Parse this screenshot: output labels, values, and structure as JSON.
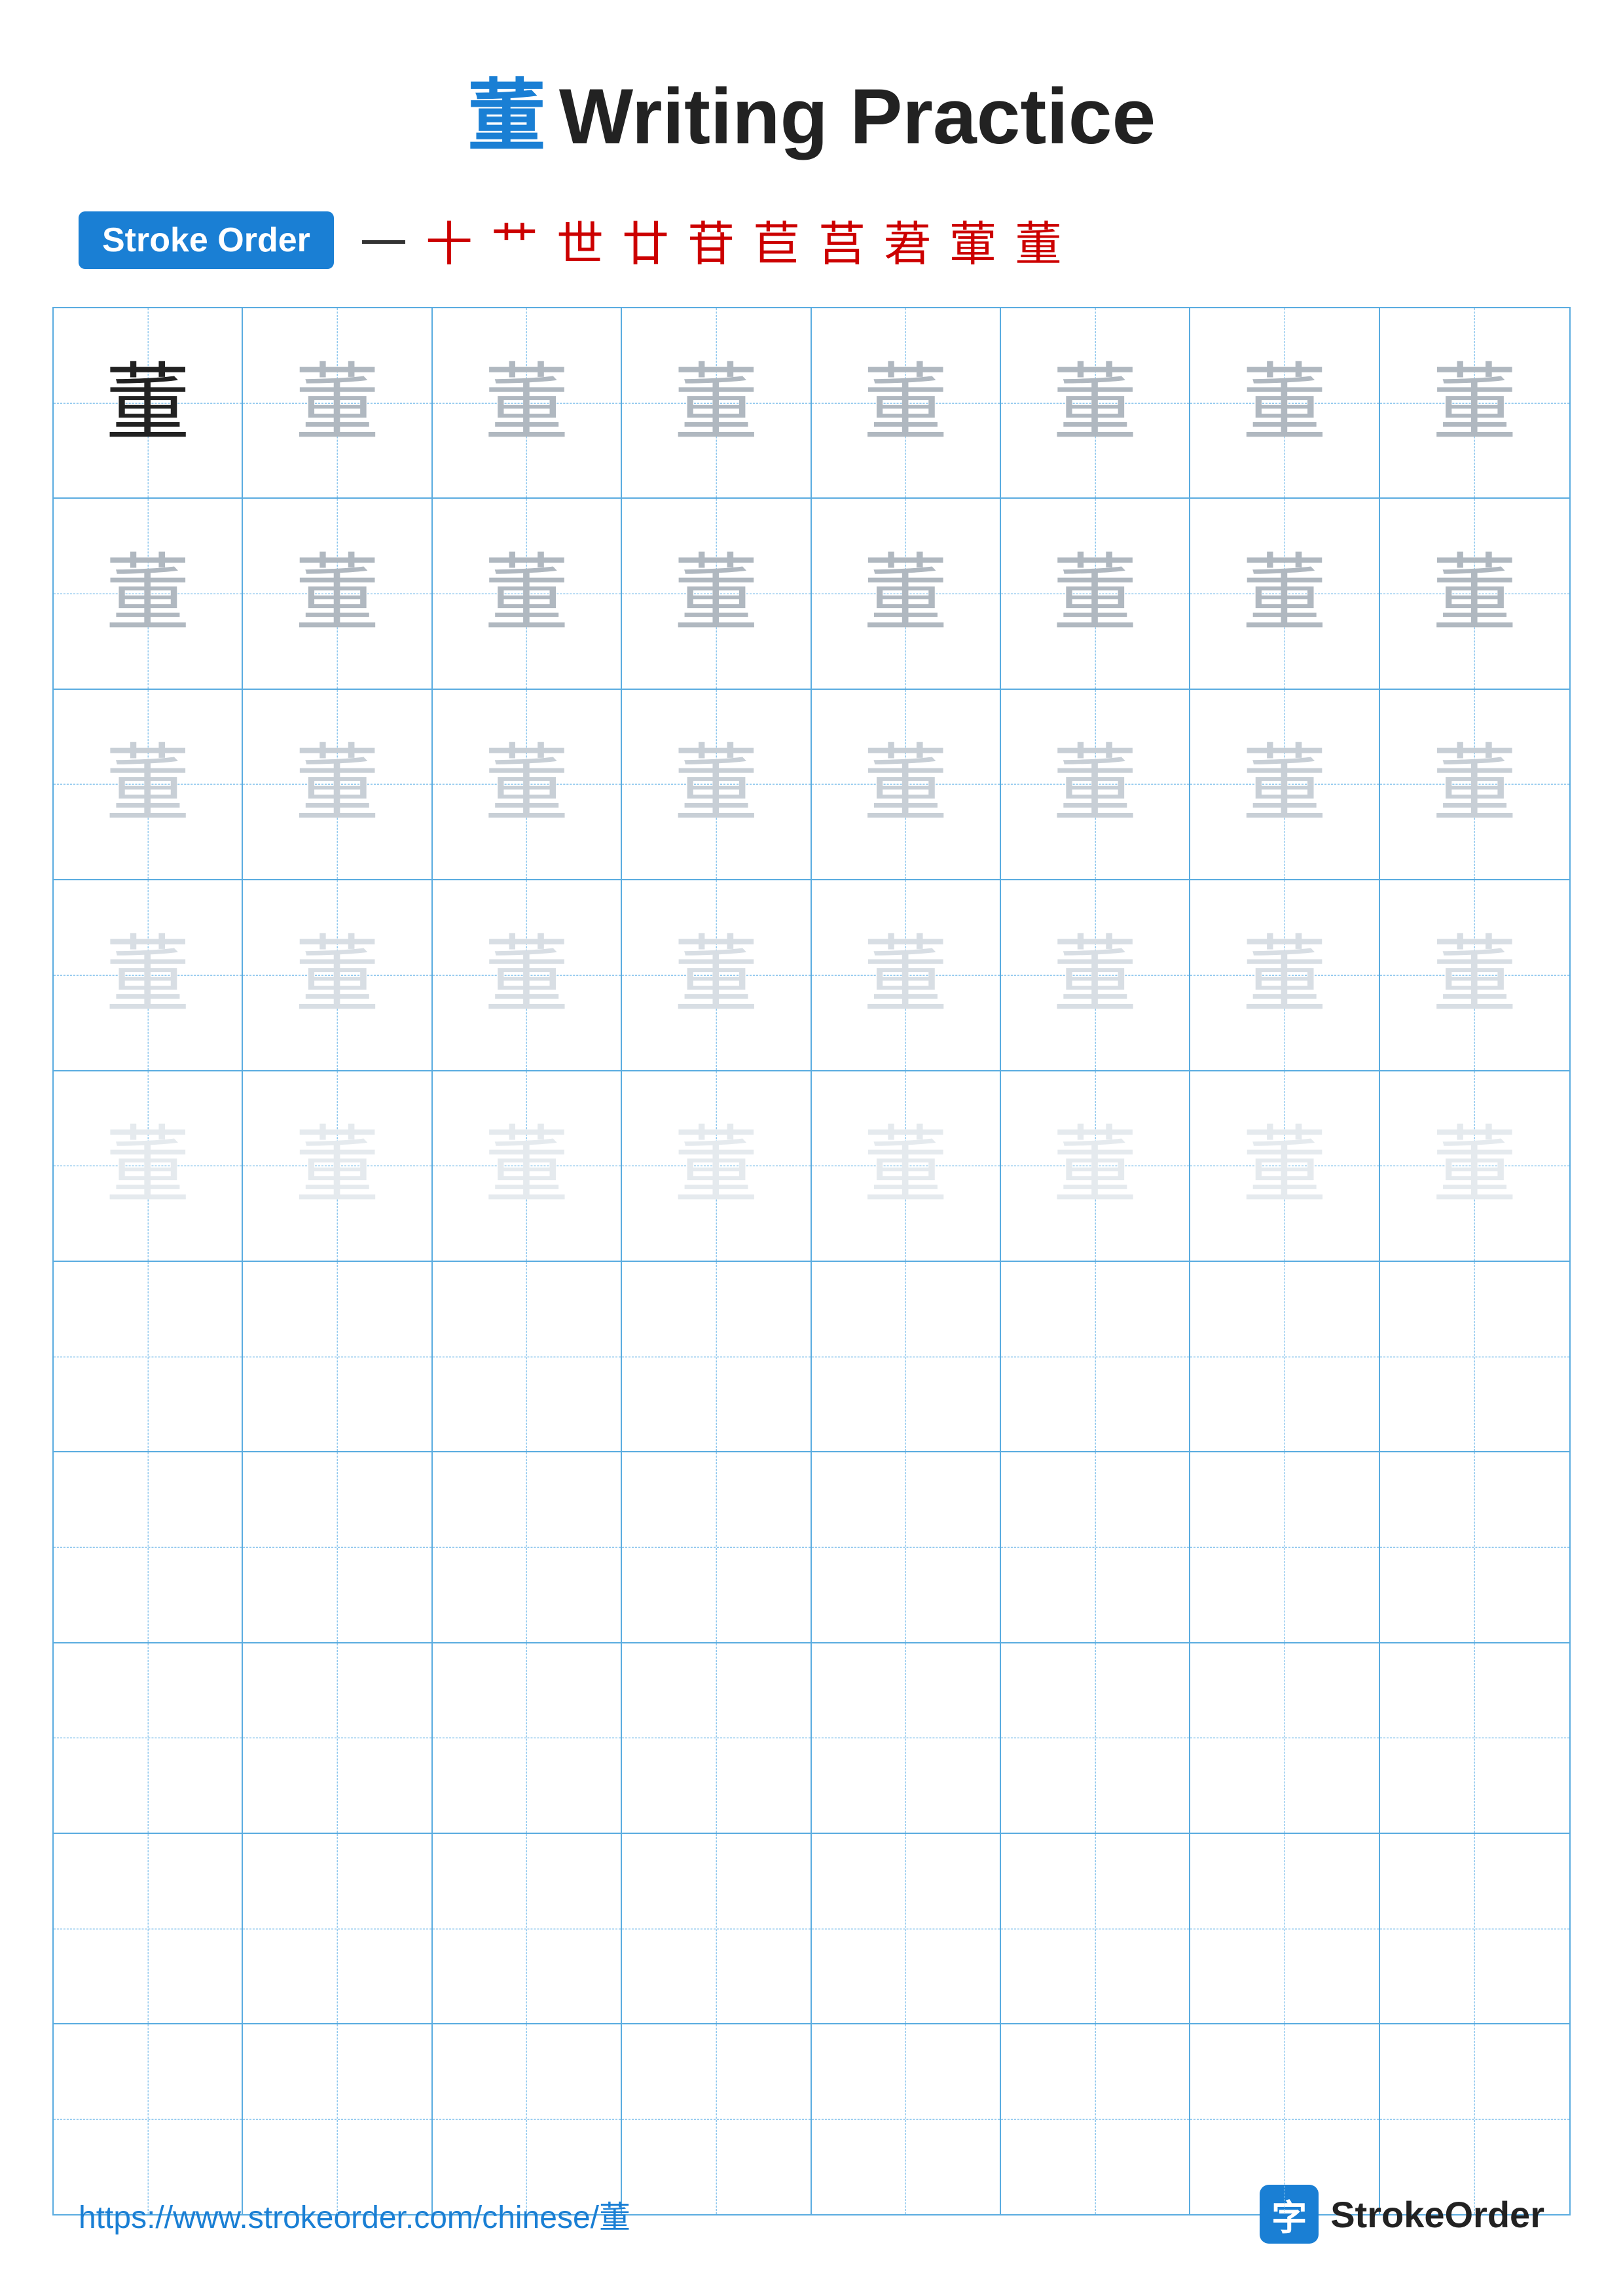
{
  "title": {
    "char": "董",
    "text": "Writing Practice"
  },
  "stroke_order": {
    "badge_label": "Stroke Order",
    "strokes": [
      "一",
      "十",
      "艹",
      "世",
      "廿",
      "苷",
      "苣",
      "莒",
      "莙",
      "葷",
      "董"
    ]
  },
  "grid": {
    "rows": 10,
    "cols": 8,
    "character": "董",
    "row_configs": [
      {
        "type": "dark_then_gray1"
      },
      {
        "type": "gray1"
      },
      {
        "type": "gray2"
      },
      {
        "type": "gray3"
      },
      {
        "type": "gray4"
      },
      {
        "type": "empty"
      },
      {
        "type": "empty"
      },
      {
        "type": "empty"
      },
      {
        "type": "empty"
      },
      {
        "type": "empty"
      }
    ]
  },
  "footer": {
    "url": "https://www.strokeorder.com/chinese/董",
    "brand_char": "字",
    "brand_name": "StrokeOrder"
  }
}
